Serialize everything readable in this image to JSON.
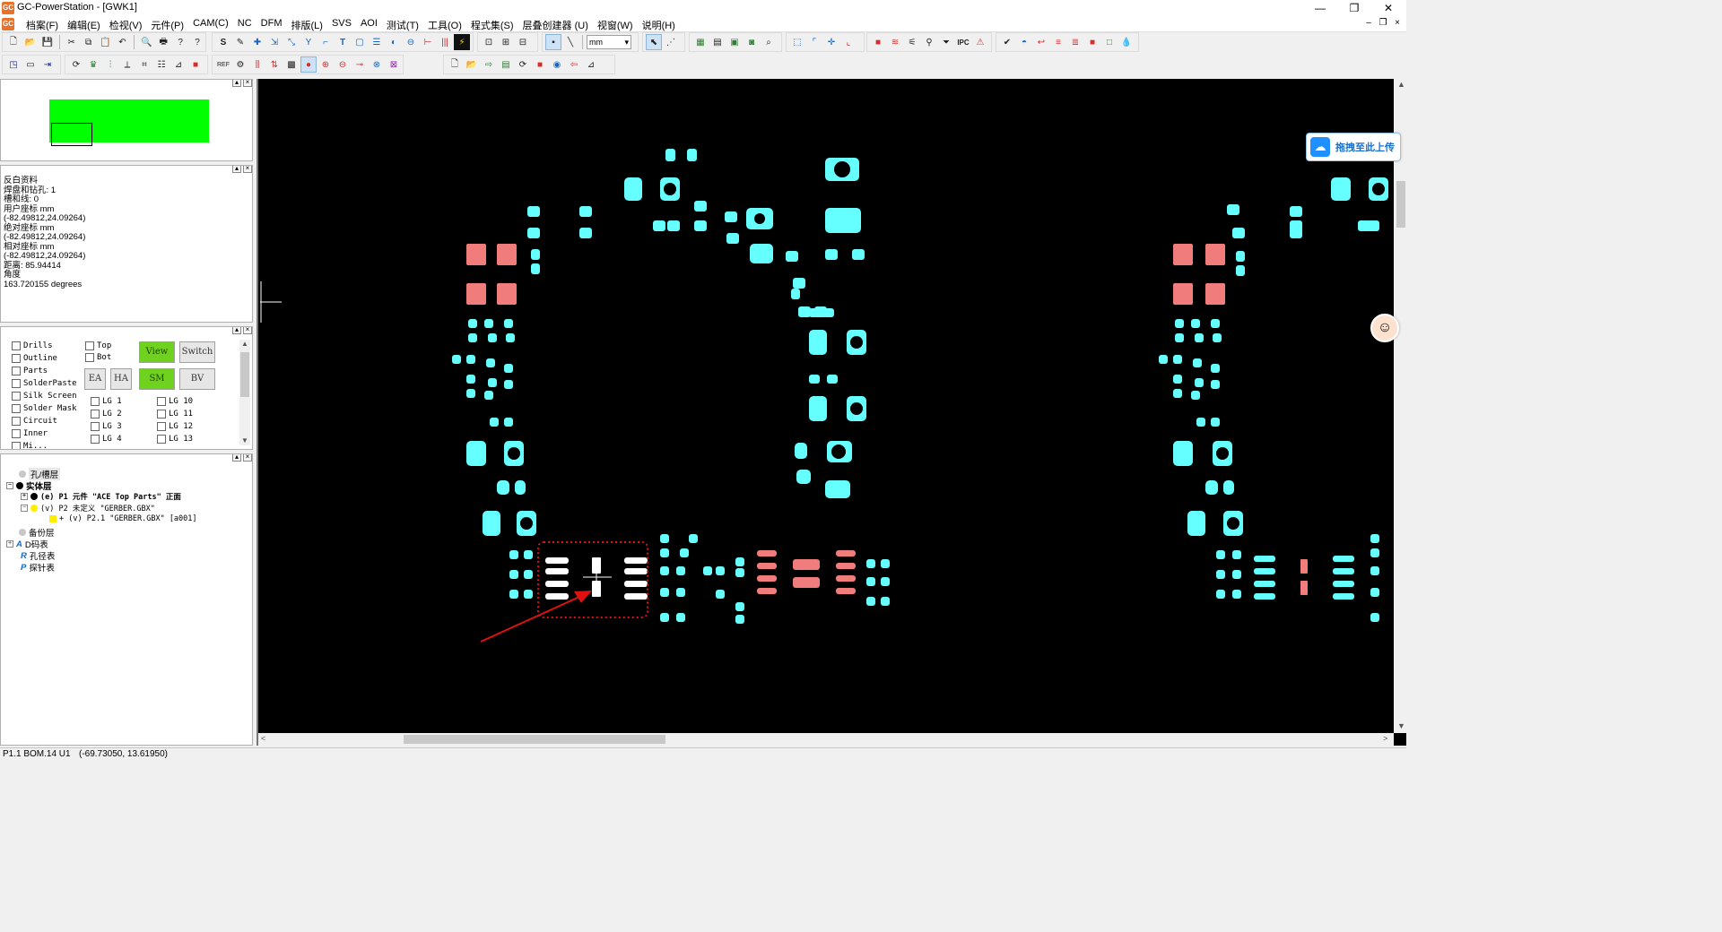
{
  "window": {
    "title": "GC-PowerStation - [GWK1]",
    "app_icon": "GC",
    "controls": [
      "—",
      "❐",
      "✕"
    ]
  },
  "menu": {
    "items": [
      "档案(F)",
      "编辑(E)",
      "检视(V)",
      "元件(P)",
      "CAM(C)",
      "NC",
      "DFM",
      "排版(L)",
      "SVS",
      "AOI",
      "测试(T)",
      "工具(O)",
      "程式集(S)",
      "层叠创建器 (U)",
      "视窗(W)",
      "说明(H)"
    ],
    "mdi_controls": [
      "–",
      "❐",
      "×"
    ]
  },
  "toolbar": {
    "unit_select": "mm"
  },
  "info_panel": {
    "lines": [
      "反白资料",
      " 焊盘和钻孔: 1",
      " 槽和线: 0",
      "用户座标 mm",
      " (-82.49812,24.09264)",
      "绝对座标 mm",
      " (-82.49812,24.09264)",
      "相对座标 mm",
      " (-82.49812,24.09264)",
      " 距离: 85.94414",
      "角度",
      " 163.720155 degrees"
    ]
  },
  "layer_panel": {
    "left_checks": [
      "Drills",
      "Outline",
      "Parts",
      "SolderPaste",
      "Silk Screen",
      "Solder Mask",
      "Circuit",
      "Inner",
      "Mi..."
    ],
    "side_checks": [
      "Top",
      "Bot"
    ],
    "buttons": {
      "view": "View",
      "switch": "Switch",
      "ea": "EA",
      "ha": "HA",
      "sm": "SM",
      "bv": "BV"
    },
    "lg_col1": [
      "LG 1",
      "LG 2",
      "LG 3",
      "LG 4"
    ],
    "lg_col2": [
      "LG 10",
      "LG 11",
      "LG 12",
      "LG 13"
    ]
  },
  "tree": {
    "holes": "孔/槽层",
    "solid": "实体层",
    "p1": "(e) P1 元件 \"ACE Top Parts\" 正面",
    "p2": "(v) P2 未定义 \"GERBER.GBX\"",
    "p21": "+ (v) P2.1 \"GERBER.GBX\" [a001]",
    "backup": "备份层",
    "dcode": "D码表",
    "drill_table": "孔径表",
    "probe_table": "探针表"
  },
  "overlay": {
    "upload_label": "拖拽至此上传",
    "upload_icon": "cloud-icon",
    "assistant_icon": "assistant-avatar-icon"
  },
  "status": {
    "component": "P1.1 BOM.14 U1",
    "coords": "(-69.73050,   13.61950)"
  },
  "colors": {
    "pad_cyan": "#66ffff",
    "pad_salmon": "#f07c7c",
    "pad_selected": "#ffffff",
    "highlight_box": "#e01010",
    "board_overview": "#00ff00"
  }
}
